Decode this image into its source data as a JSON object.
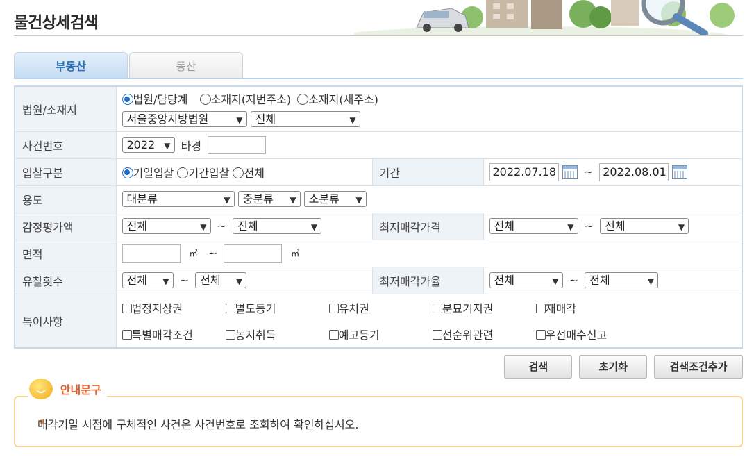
{
  "header": {
    "title": "물건상세검색"
  },
  "tabs": [
    {
      "label": "부동산",
      "active": true
    },
    {
      "label": "동산",
      "active": false
    }
  ],
  "form": {
    "court": {
      "label": "법원/소재지",
      "radios": [
        "법원/담당계",
        "소재지(지번주소)",
        "소재지(새주소)"
      ],
      "selected_radio": "법원/담당계",
      "court_select": "서울중앙지방법원",
      "dept_select": "전체"
    },
    "case_no": {
      "label": "사건번호",
      "year_select": "2022",
      "suffix": "타경",
      "value": ""
    },
    "bid_type": {
      "label": "입찰구분",
      "radios": [
        "기일입찰",
        "기간입찰",
        "전체"
      ],
      "selected_radio": "기일입찰",
      "period_label": "기간",
      "date_from": "2022.07.18",
      "date_to": "2022.08.01"
    },
    "usage": {
      "label": "용도",
      "major": "대분류",
      "middle": "중분류",
      "minor": "소분류"
    },
    "appraisal": {
      "label": "감정평가액",
      "from": "전체",
      "to": "전체"
    },
    "min_price": {
      "label": "최저매각가격",
      "from": "전체",
      "to": "전체"
    },
    "area": {
      "label": "면적",
      "unit": "㎡",
      "from": "",
      "to": ""
    },
    "fail_count": {
      "label": "유찰횟수",
      "from": "전체",
      "to": "전체"
    },
    "min_rate": {
      "label": "최저매각가율",
      "from": "전체",
      "to": "전체"
    },
    "special": {
      "label": "특이사항",
      "row1": [
        "법정지상권",
        "별도등기",
        "유치권",
        "분묘기지권",
        "재매각"
      ],
      "row2": [
        "특별매각조건",
        "농지취득",
        "예고등기",
        "선순위관련",
        "우선매수신고"
      ]
    },
    "tilde": "~"
  },
  "buttons": {
    "search": "검색",
    "reset": "초기화",
    "add_condition": "검색조건추가"
  },
  "notice": {
    "title": "안내문구",
    "text": "매각기일 시점에 구체적인 사건은 사건번호로 조회하여 확인하십시오."
  }
}
